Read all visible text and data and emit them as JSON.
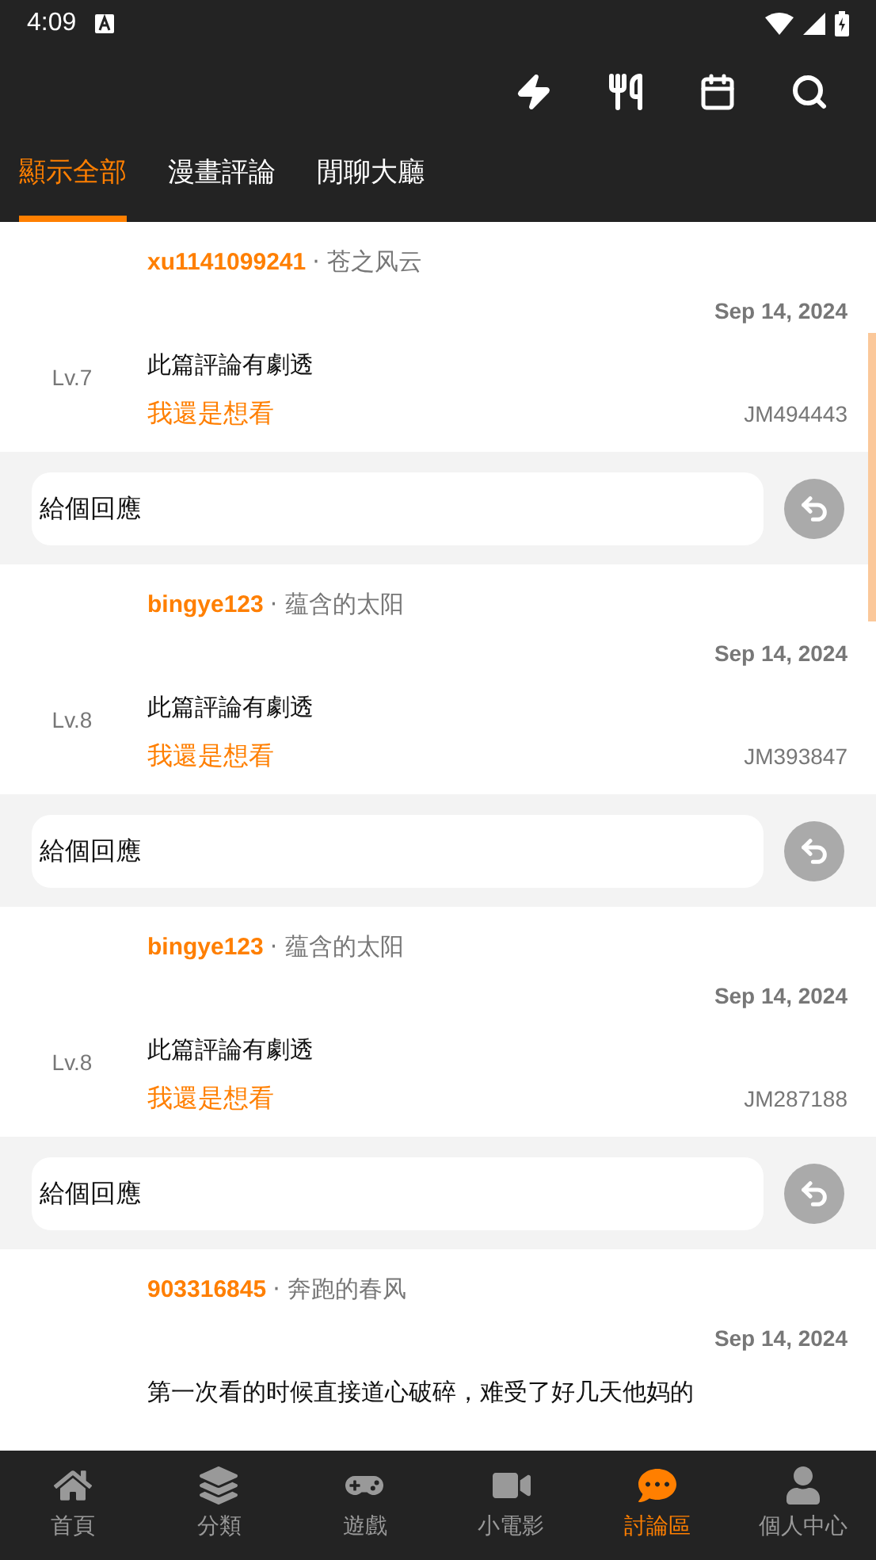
{
  "status_bar": {
    "time": "4:09"
  },
  "tabs": [
    {
      "label": "顯示全部",
      "selected": true
    },
    {
      "label": "漫畫評論",
      "selected": false
    },
    {
      "label": "閒聊大廳",
      "selected": false
    }
  ],
  "comments": [
    {
      "user": "xu1141099241",
      "nickname": "· 苍之风云",
      "date": "Sep 14, 2024",
      "level": "Lv.7",
      "text": "此篇評論有劇透",
      "link": "我還是想看",
      "code": "JM494443",
      "reply_placeholder": "給個回應"
    },
    {
      "user": "bingye123",
      "nickname": "· 蕴含的太阳",
      "date": "Sep 14, 2024",
      "level": "Lv.8",
      "text": "此篇評論有劇透",
      "link": "我還是想看",
      "code": "JM393847",
      "reply_placeholder": "給個回應"
    },
    {
      "user": "bingye123",
      "nickname": "· 蕴含的太阳",
      "date": "Sep 14, 2024",
      "level": "Lv.8",
      "text": "此篇評論有劇透",
      "link": "我還是想看",
      "code": "JM287188",
      "reply_placeholder": "給個回應"
    },
    {
      "user": "903316845",
      "nickname": "· 奔跑的春风",
      "date": "Sep 14, 2024",
      "text": "第一次看的时候直接道心破碎，难受了好几天他妈的"
    }
  ],
  "nav": [
    {
      "label": "首頁",
      "selected": false
    },
    {
      "label": "分類",
      "selected": false
    },
    {
      "label": "遊戲",
      "selected": false
    },
    {
      "label": "小電影",
      "selected": false
    },
    {
      "label": "討論區",
      "selected": true
    },
    {
      "label": "個人中心",
      "selected": false
    }
  ]
}
